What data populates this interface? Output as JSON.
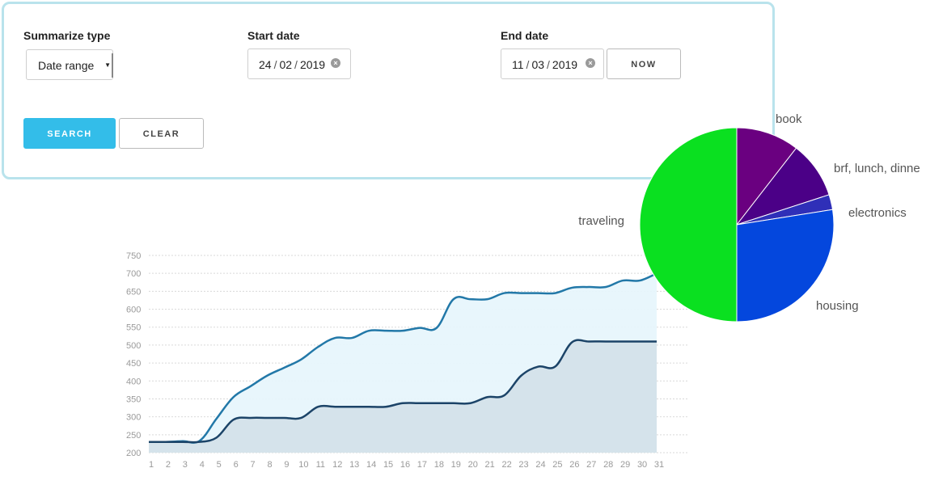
{
  "filters": {
    "summarize_label": "Summarize type",
    "summarize_value": "Date range",
    "start_label": "Start date",
    "start_date": {
      "day": "24",
      "month": "02",
      "year": "2019"
    },
    "end_label": "End date",
    "end_date": {
      "day": "11",
      "month": "03",
      "year": "2019"
    },
    "now_button": "NOW",
    "search_button": "SEARCH",
    "clear_button": "CLEAR",
    "date_separator": "/"
  },
  "colors": {
    "panel_border": "#b9e3ec",
    "primary_button": "#33bde9"
  },
  "chart_data": [
    {
      "type": "area",
      "x": [
        1,
        2,
        3,
        4,
        5,
        6,
        7,
        8,
        9,
        10,
        11,
        12,
        13,
        14,
        15,
        16,
        17,
        18,
        19,
        20,
        21,
        22,
        23,
        24,
        25,
        26,
        27,
        28,
        29,
        30,
        31
      ],
      "series": [
        {
          "color": "#2278a8",
          "fill": "#e7f5fc",
          "values": [
            230,
            230,
            232,
            233,
            295,
            355,
            385,
            415,
            437,
            460,
            495,
            520,
            520,
            540,
            540,
            540,
            548,
            548,
            628,
            628,
            628,
            645,
            645,
            645,
            645,
            660,
            662,
            662,
            680,
            680,
            700
          ]
        },
        {
          "color": "#1c4468",
          "fill": "#d4e2ea",
          "values": [
            230,
            230,
            230,
            230,
            242,
            292,
            297,
            297,
            297,
            297,
            328,
            328,
            328,
            328,
            328,
            338,
            338,
            338,
            338,
            338,
            355,
            360,
            415,
            440,
            440,
            508,
            510,
            510,
            510,
            510,
            510
          ]
        }
      ],
      "yticks": [
        200,
        250,
        300,
        350,
        400,
        450,
        500,
        550,
        600,
        650,
        700,
        750
      ],
      "ylim": [
        200,
        750
      ],
      "xlim": [
        1,
        31
      ],
      "grid": true
    },
    {
      "type": "pie",
      "slices": [
        {
          "label": "book",
          "value": 10.5,
          "color": "#6a0080"
        },
        {
          "label": "brf, lunch, dinne",
          "value": 9.5,
          "color": "#4b0087"
        },
        {
          "label": "electronics",
          "value": 2.5,
          "color": "#2f2fb8"
        },
        {
          "label": "housing",
          "value": 27.5,
          "color": "#0447dd"
        },
        {
          "label": "traveling",
          "value": 50,
          "color": "#0ae020"
        }
      ]
    }
  ]
}
